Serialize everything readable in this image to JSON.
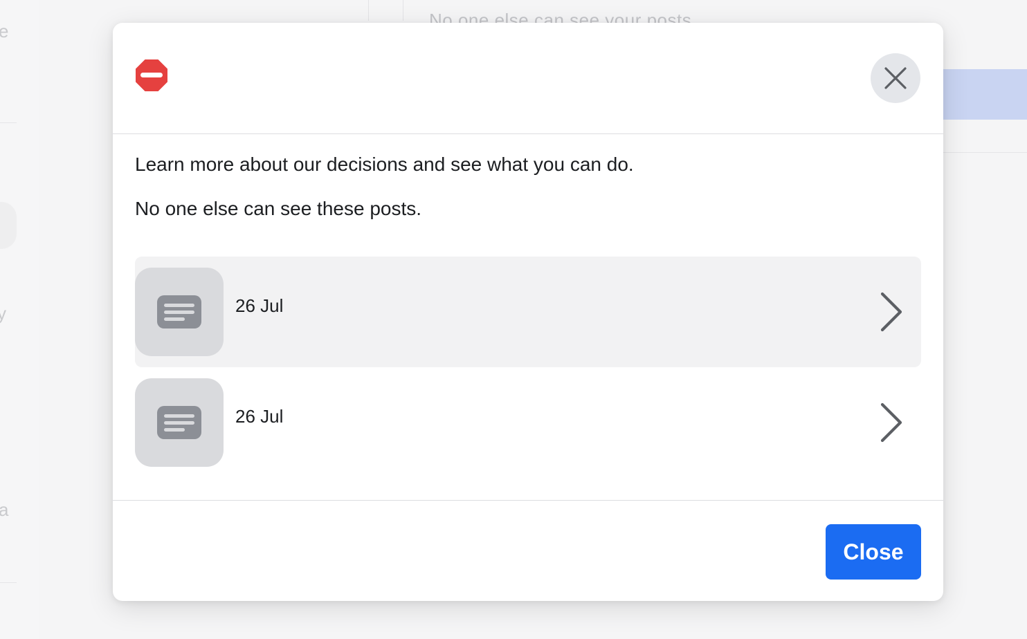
{
  "background": {
    "top_text": "No one else can see your posts",
    "left_fragments": [
      "e",
      "y",
      "a"
    ]
  },
  "modal": {
    "header": {
      "status_icon": "stop-sign-icon",
      "status_color": "#e5413f",
      "close_icon": "close-icon"
    },
    "intro": [
      "Learn more about our decisions and see what you can do.",
      "No one else can see these posts."
    ],
    "posts": [
      {
        "date": "26 Jul",
        "thumbnail_icon": "text-post-icon",
        "arrow_icon": "chevron-right-icon",
        "highlighted": true
      },
      {
        "date": "26 Jul",
        "thumbnail_icon": "text-post-icon",
        "arrow_icon": "chevron-right-icon",
        "highlighted": false
      }
    ],
    "footer": {
      "close_label": "Close",
      "close_color": "#1b6cf2"
    }
  }
}
